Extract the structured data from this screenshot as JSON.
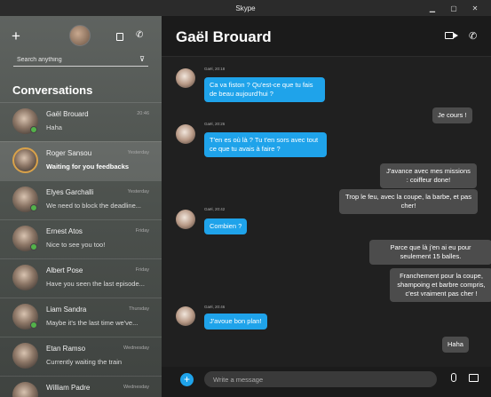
{
  "window": {
    "title": "Skype",
    "minimize": "▁",
    "maximize": "▢",
    "close": "✕"
  },
  "sidebar": {
    "add_glyph": "+",
    "call_glyph": "✆",
    "filter_glyph": "⊽",
    "search_placeholder": "Search anything",
    "conversations_title": "Conversations",
    "items": [
      {
        "name": "Gaël Brouard",
        "preview": "Haha",
        "time": "20:46",
        "active": false,
        "online": true
      },
      {
        "name": "Roger Sansou",
        "preview": "Waiting for you feedbacks",
        "time": "Yesterday",
        "active": true,
        "online": false
      },
      {
        "name": "Elyes Garchalli",
        "preview": "We need to block the deadline...",
        "time": "Yesterday",
        "active": false,
        "online": true
      },
      {
        "name": "Ernest Atos",
        "preview": "Nice to see you too!",
        "time": "Friday",
        "active": false,
        "online": true
      },
      {
        "name": "Albert Pose",
        "preview": "Have you seen the last episode...",
        "time": "Friday",
        "active": false,
        "online": false
      },
      {
        "name": "Liam Sandra",
        "preview": "Maybe it's the last time we've...",
        "time": "Thursday",
        "active": false,
        "online": true
      },
      {
        "name": "Etan Ramso",
        "preview": "Currently waiting the train",
        "time": "Wednesday",
        "active": false,
        "online": false
      },
      {
        "name": "William Padre",
        "preview": "",
        "time": "Wednesday",
        "active": false,
        "online": false
      }
    ]
  },
  "chat": {
    "contact_name": "Gaël Brouard",
    "call_glyph": "✆",
    "composer_plus": "+",
    "composer_placeholder": "Write a message",
    "messages": [
      {
        "dir": "in",
        "meta": "Gaël, 20:18",
        "text": "Ca va fiston ? Qu'est-ce que tu fais de beau aujourd'hui ?"
      },
      {
        "dir": "out",
        "text": "Je cours !"
      },
      {
        "dir": "in",
        "meta": "Gaël, 20:26",
        "text": "T'en es où là ? Tu t'en sors avec tout ce que tu avais à faire ?"
      },
      {
        "dir": "out",
        "text": "J'avance avec mes missions : coiffeur done!"
      },
      {
        "dir": "out",
        "text": "Trop le feu, avec la coupe, la barbe, et pas cher!"
      },
      {
        "dir": "in",
        "meta": "Gaël, 20:42",
        "text": "Combien ?"
      },
      {
        "dir": "out",
        "text": "Parce que là j'en ai eu pour seulement 15 balles."
      },
      {
        "dir": "out",
        "text": "Franchement pour la coupe, shampoing et barbre compris, c'est vraiment pas cher !"
      },
      {
        "dir": "in",
        "meta": "Gaël, 20:46",
        "text": "J'avoue bon plan!"
      },
      {
        "dir": "out",
        "text": "Haha"
      }
    ]
  },
  "colors": {
    "accent": "#1fa3ea",
    "online": "#53b24a",
    "active_ring": "#d9a24a"
  }
}
